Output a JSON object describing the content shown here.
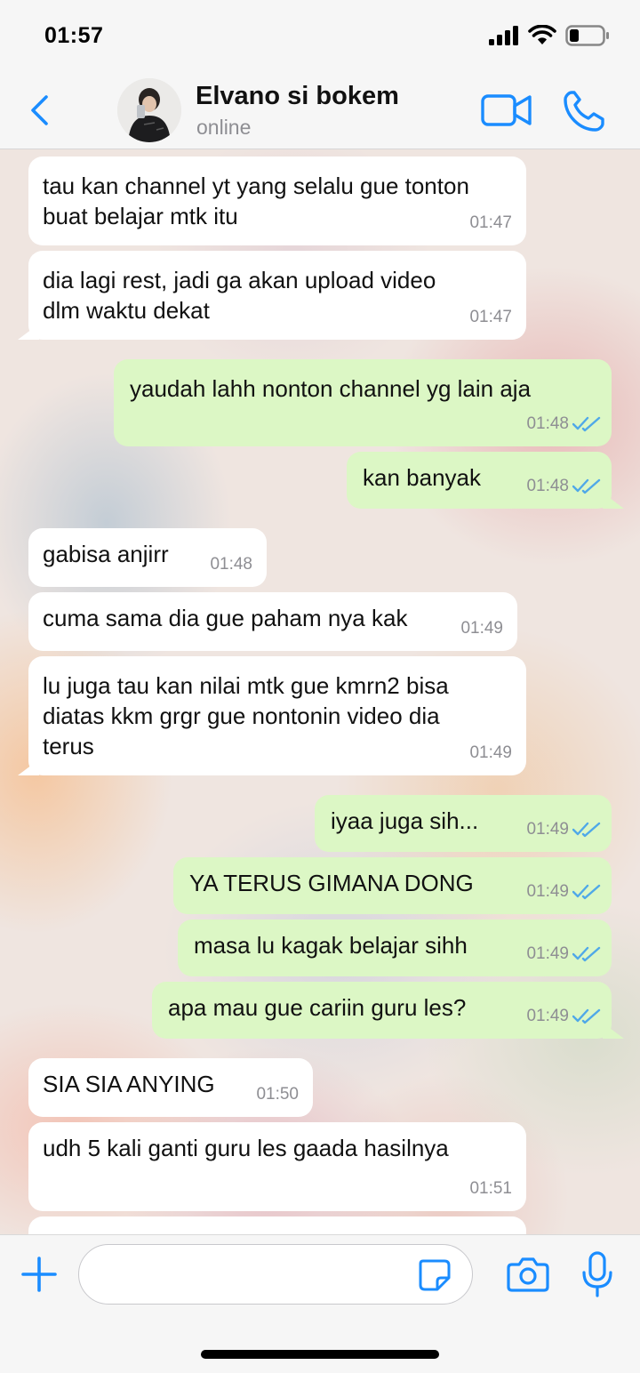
{
  "status_bar": {
    "time": "01:57"
  },
  "header": {
    "contact_name": "Elvano si bokem",
    "contact_status": "online"
  },
  "colors": {
    "accent": "#1a8cff",
    "bubble_incoming": "#ffffff",
    "bubble_outgoing": "#dcf7c5",
    "read_ticks": "#4fa8e8"
  },
  "messages": [
    {
      "dir": "in",
      "lines": [
        "tau kan channel yt yang selalu gue tonton",
        "buat belajar mtk itu"
      ],
      "time": "01:47"
    },
    {
      "dir": "in",
      "lines": [
        "dia lagi rest, jadi ga akan upload video",
        "dlm waktu dekat"
      ],
      "time": "01:47"
    },
    {
      "dir": "out",
      "lines": [
        "yaudah lahh nonton channel yg lain aja"
      ],
      "time": "01:48"
    },
    {
      "dir": "out",
      "lines": [
        "kan banyak"
      ],
      "time": "01:48"
    },
    {
      "dir": "in",
      "lines": [
        "gabisa anjirr"
      ],
      "time": "01:48"
    },
    {
      "dir": "in",
      "lines": [
        "cuma sama dia gue paham nya kak"
      ],
      "time": "01:49"
    },
    {
      "dir": "in",
      "lines": [
        "lu juga tau kan nilai mtk gue kmrn2 bisa",
        "diatas kkm grgr gue nontonin video dia",
        "terus"
      ],
      "time": "01:49"
    },
    {
      "dir": "out",
      "lines": [
        "iyaa juga sih..."
      ],
      "time": "01:49"
    },
    {
      "dir": "out",
      "lines": [
        "YA TERUS GIMANA DONG"
      ],
      "time": "01:49"
    },
    {
      "dir": "out",
      "lines": [
        "masa lu kagak belajar sihh"
      ],
      "time": "01:49"
    },
    {
      "dir": "out",
      "lines": [
        "apa mau gue cariin guru les?"
      ],
      "time": "01:49"
    },
    {
      "dir": "in",
      "lines": [
        "SIA SIA ANYING"
      ],
      "time": "01:50"
    },
    {
      "dir": "in",
      "lines": [
        "udh 5 kali ganti guru les gaada hasilnya"
      ],
      "time": "01:51"
    },
    {
      "dir": "in",
      "lines": [
        ""
      ],
      "time": ""
    }
  ],
  "input": {
    "placeholder": ""
  }
}
